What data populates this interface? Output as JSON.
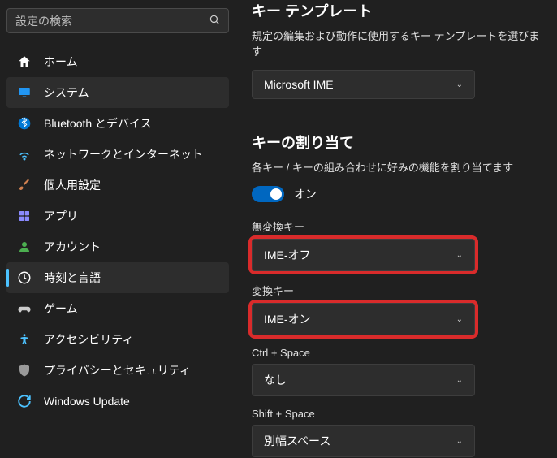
{
  "search": {
    "placeholder": "設定の検索"
  },
  "sidebar": {
    "items": [
      {
        "label": "ホーム"
      },
      {
        "label": "システム"
      },
      {
        "label": "Bluetooth とデバイス"
      },
      {
        "label": "ネットワークとインターネット"
      },
      {
        "label": "個人用設定"
      },
      {
        "label": "アプリ"
      },
      {
        "label": "アカウント"
      },
      {
        "label": "時刻と言語"
      },
      {
        "label": "ゲーム"
      },
      {
        "label": "アクセシビリティ"
      },
      {
        "label": "プライバシーとセキュリティ"
      },
      {
        "label": "Windows Update"
      }
    ]
  },
  "content": {
    "templateTitle": "キー テンプレート",
    "templateDesc": "規定の編集および動作に使用するキー テンプレートを選びます",
    "templateValue": "Microsoft IME",
    "assignTitle": "キーの割り当て",
    "assignDesc": "各キー / キーの組み合わせに好みの機能を割り当てます",
    "toggleLabel": "オン",
    "fields": {
      "muhenkan": {
        "label": "無変換キー",
        "value": "IME-オフ"
      },
      "henkan": {
        "label": "変換キー",
        "value": "IME-オン"
      },
      "ctrlspace": {
        "label": "Ctrl + Space",
        "value": "なし"
      },
      "shiftspace": {
        "label": "Shift + Space",
        "value": "別幅スペース"
      }
    }
  }
}
